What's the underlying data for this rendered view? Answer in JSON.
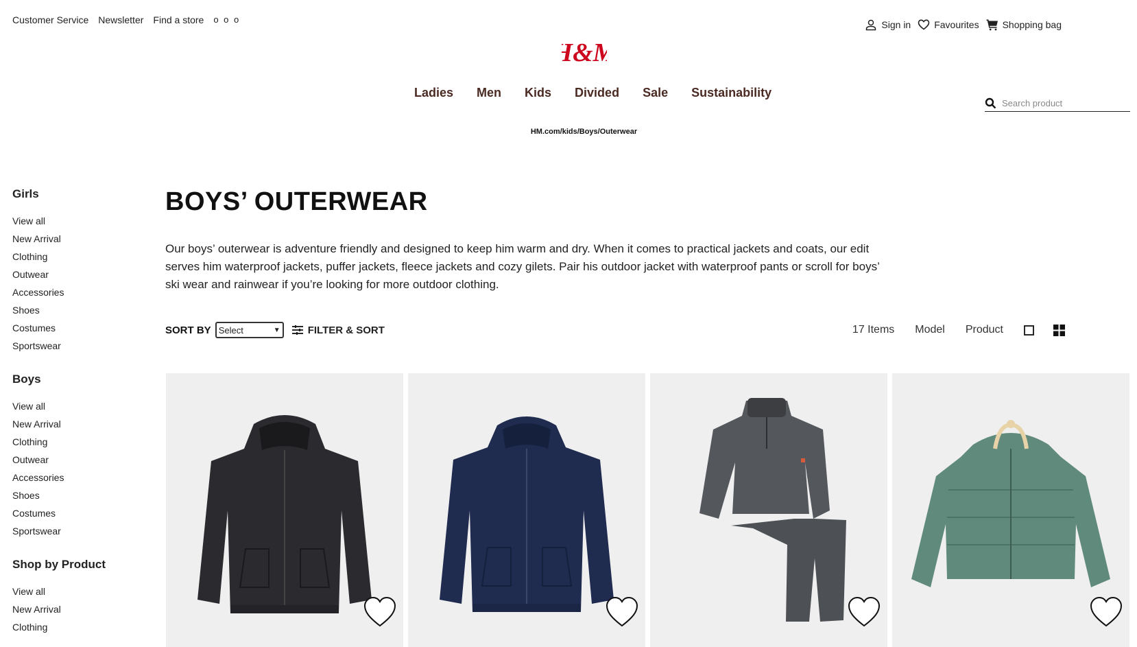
{
  "utility": {
    "links": [
      "Customer Service",
      "Newsletter",
      "Find a store"
    ],
    "more": "o o o",
    "sign_in": "Sign in",
    "favourites": "Favourites",
    "shopping_bag": "Shopping bag"
  },
  "brand": {
    "logo": "H&M",
    "color": "#cc071e"
  },
  "nav": [
    "Ladies",
    "Men",
    "Kids",
    "Divided",
    "Sale",
    "Sustainability"
  ],
  "search": {
    "placeholder": "Search product"
  },
  "breadcrumb": "HM.com/kids/Boys/Outerwear",
  "sidebar": [
    {
      "title": "Girls",
      "items": [
        "View all",
        "New Arrival",
        "Clothing",
        "Outwear",
        "Accessories",
        "Shoes",
        "Costumes",
        "Sportswear"
      ]
    },
    {
      "title": "Boys",
      "items": [
        "View all",
        "New Arrival",
        "Clothing",
        "Outwear",
        "Accessories",
        "Shoes",
        "Costumes",
        "Sportswear"
      ]
    },
    {
      "title": "Shop by Product",
      "items": [
        "View all",
        "New Arrival",
        "Clothing"
      ]
    }
  ],
  "page": {
    "title": "BOYS’ OUTERWEAR",
    "description": "Our boys’ outerwear is adventure friendly and designed to keep him warm and dry. When it comes to practical jackets and coats, our edit serves him waterproof jackets, puffer jackets, fleece jackets and cozy gilets. Pair his outdoor jacket with waterproof pants or scroll for boys’ ski wear and rainwear if you’re looking for more outdoor clothing."
  },
  "toolbar": {
    "sort_label": "SORT BY",
    "sort_value": "Select",
    "filter_label": "FILTER & SORT",
    "item_count": "17 Items",
    "model_label": "Model",
    "product_label": "Product"
  },
  "products": [
    {
      "image": "black-zip-hoodie",
      "color": "#2b2a2e"
    },
    {
      "image": "navy-zip-hoodie",
      "color": "#1f2b4f"
    },
    {
      "image": "grey-fleece-set",
      "color": "#54575c"
    },
    {
      "image": "green-puffer-jacket",
      "color": "#5f8a7c"
    }
  ]
}
